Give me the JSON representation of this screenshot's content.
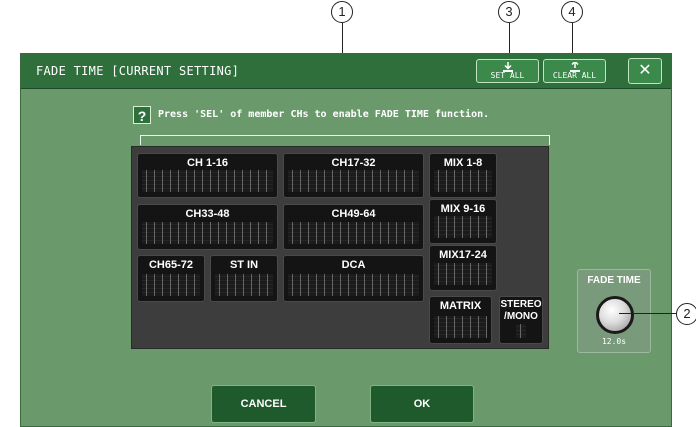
{
  "callouts": [
    "1",
    "2",
    "3",
    "4"
  ],
  "window": {
    "title": "FADE TIME [CURRENT SETTING]",
    "set_all_label": "SET ALL",
    "clear_all_label": "CLEAR ALL",
    "close_label": "✕"
  },
  "help": {
    "icon_label": "?",
    "instruction": "Press 'SEL' of member CHs to enable FADE TIME function."
  },
  "groups": {
    "ch_1_16": "CH 1-16",
    "ch_17_32": "CH17-32",
    "ch_33_48": "CH33-48",
    "ch_49_64": "CH49-64",
    "ch_65_72": "CH65-72",
    "st_in": "ST IN",
    "dca": "DCA",
    "mix_1_8": "MIX 1-8",
    "mix_9_16": "MIX 9-16",
    "mix_17_24": "MIX17-24",
    "matrix": "MATRIX",
    "stereo_mono": "STEREO\n/MONO"
  },
  "fade_time": {
    "label": "FADE TIME",
    "value": "12.0s"
  },
  "buttons": {
    "cancel": "CANCEL",
    "ok": "OK"
  },
  "colors": {
    "title_bar": "#2f6f3c",
    "window_bg": "#6a9a6c",
    "panel_bg": "#3d3d3d",
    "group_bg": "#141414"
  }
}
